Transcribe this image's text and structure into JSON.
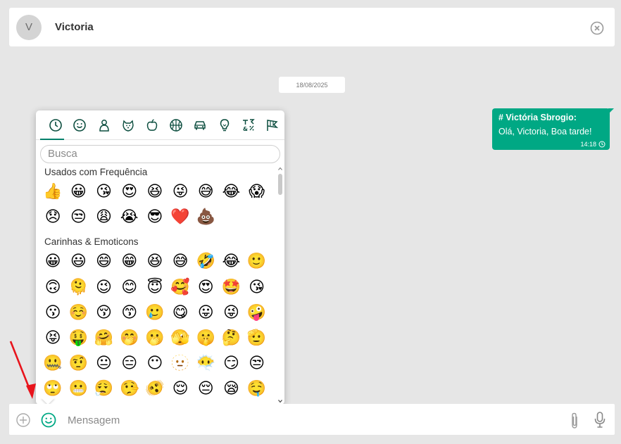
{
  "header": {
    "avatar_letter": "V",
    "contact_name": "Victoria"
  },
  "date_separator": "18/08/2025",
  "message": {
    "sender": "# Victória Sbrogio:",
    "text": "Olá, Victoria, Boa tarde!",
    "time": "14:18",
    "bubble_color": "#00a884"
  },
  "emoji_picker": {
    "categories": [
      "clock-icon",
      "smiley-icon",
      "person-icon",
      "animal-icon",
      "food-icon",
      "ball-icon",
      "car-icon",
      "lightbulb-icon",
      "symbols-icon",
      "flags-icon"
    ],
    "active_category": "clock-icon",
    "search_placeholder": "Busca",
    "sections": [
      {
        "title": "Usados com Frequência",
        "emojis": [
          "👍",
          "😀",
          "😘",
          "😍",
          "😆",
          "😜",
          "😅",
          "😂",
          "😱",
          "😞",
          "😒",
          "😩",
          "😭",
          "😎",
          "❤️",
          "💩"
        ]
      },
      {
        "title": "Carinhas & Emoticons",
        "emojis": [
          "😀",
          "😃",
          "😄",
          "😁",
          "😆",
          "😅",
          "🤣",
          "😂",
          "🙂",
          "🙃",
          "🫠",
          "😉",
          "😊",
          "😇",
          "🥰",
          "😍",
          "🤩",
          "😘",
          "😗",
          "☺️",
          "😚",
          "😙",
          "🥲",
          "😋",
          "😛",
          "😜",
          "🤪",
          "😝",
          "🤑",
          "🤗",
          "🤭",
          "🫢",
          "🫣",
          "🤫",
          "🤔",
          "🫡",
          "🤐",
          "🤨",
          "😐",
          "😑",
          "😶",
          "🫥",
          "😶‍🌫️",
          "😏",
          "😒",
          "🙄",
          "😬",
          "😮‍💨",
          "🤥",
          "🫨",
          "😌",
          "😔",
          "😪",
          "🤤"
        ]
      }
    ]
  },
  "composer": {
    "placeholder": "Mensagem"
  },
  "accent_color": "#00806a"
}
